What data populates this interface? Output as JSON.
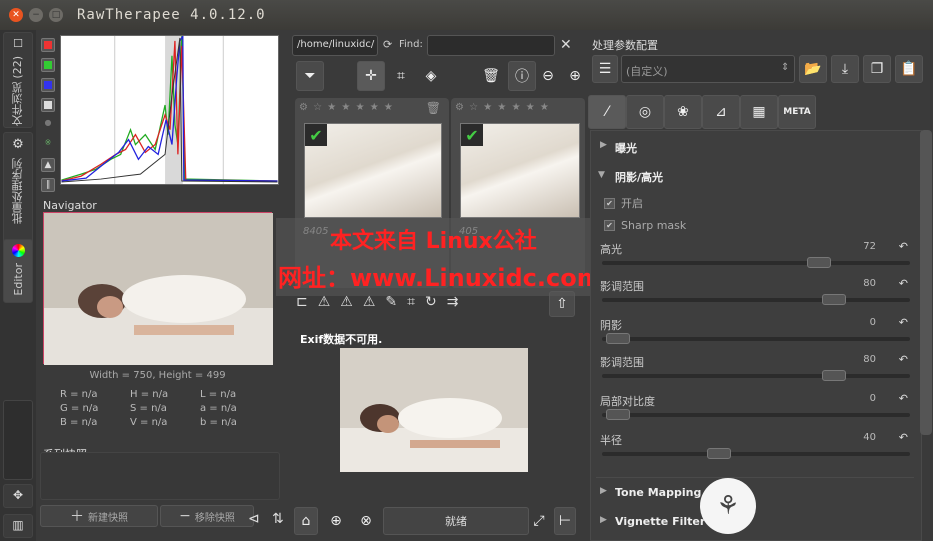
{
  "window": {
    "title": "RawTherapee 4.0.12.0"
  },
  "side_tabs": {
    "browser": "文件浏览 (22)",
    "queue": "批量处理序列",
    "editor": "Editor"
  },
  "navigator": {
    "label": "Navigator",
    "size_info": "Width = 750, Height = 499",
    "values": [
      "R = n/a",
      "H = n/a",
      "L = n/a",
      "G = n/a",
      "S = n/a",
      "a = n/a",
      "B = n/a",
      "V = n/a",
      "b = n/a"
    ]
  },
  "snapshots": {
    "label": "系列快照",
    "add": "新建快照",
    "remove": "移除快照"
  },
  "browser": {
    "path": "/home/linuxidc/",
    "find_label": "Find:",
    "find_value": ""
  },
  "thumbs": [
    {
      "name": "8405",
      "checked": true
    },
    {
      "name": "405",
      "checked": true
    }
  ],
  "exif_text": "Exif数据不可用.",
  "status": "就绪",
  "watermark": {
    "line1": "本文来自 Linux公社",
    "line2": "网址：www.Linuxidc.com"
  },
  "right": {
    "label": "处理参数配置",
    "profile": "(自定义)",
    "tabs": [
      "exposure-tab",
      "detail-tab",
      "color-tab",
      "transform-tab",
      "raw-tab",
      "META"
    ]
  },
  "tools": {
    "exposure": "曝光",
    "shadows_highlights": "阴影/高光",
    "enable": "开启",
    "sharp_mask": "Sharp mask",
    "sliders": [
      {
        "label": "高光",
        "value": "72"
      },
      {
        "label": "影调范围",
        "value": "80"
      },
      {
        "label": "阴影",
        "value": "0"
      },
      {
        "label": "影调范围",
        "value": "80"
      },
      {
        "label": "局部对比度",
        "value": "0"
      },
      {
        "label": "半径",
        "value": "40"
      }
    ],
    "tone_mapping": "Tone Mapping",
    "vignette": "Vignette Filter"
  },
  "colors": {
    "accent": "#e95420",
    "watermark": "#ff2222",
    "check": "#44cc44"
  }
}
